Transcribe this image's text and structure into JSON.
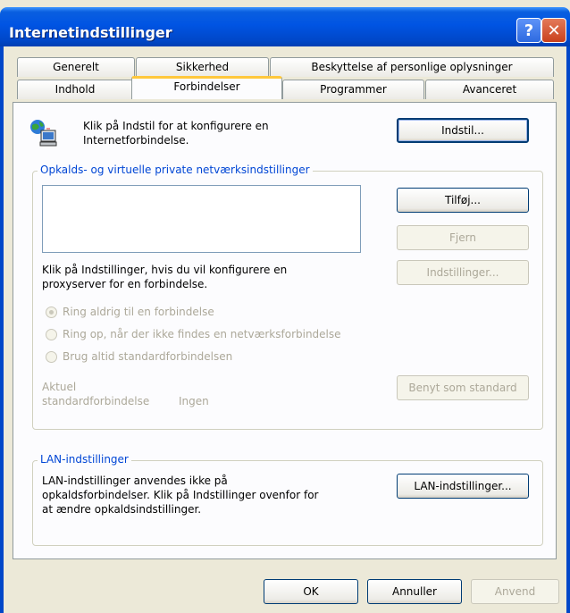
{
  "window": {
    "title": "Internetindstillinger",
    "help_label": "?",
    "close_label": "✕"
  },
  "tabs": {
    "row1": [
      "Generelt",
      "Sikkerhed",
      "Beskyttelse af personlige oplysninger"
    ],
    "row2": [
      "Indhold",
      "Forbindelser",
      "Programmer",
      "Avanceret"
    ],
    "active": "Forbindelser"
  },
  "connection": {
    "intro_text": "Klik på Indstil for at konfigurere en\nInternetforbindelse.",
    "setup_button": "Indstil...",
    "icon": "network-computer-icon"
  },
  "dialup": {
    "group_label": "Opkalds- og virtuelle private netværksindstillinger",
    "add_button": "Tilføj...",
    "remove_button": "Fjern",
    "settings_button": "Indstillinger...",
    "proxy_text": "Klik på Indstillinger, hvis du vil konfigurere en\nproxyserver for en forbindelse.",
    "radio_never": "Ring aldrig til en forbindelse",
    "radio_when_no_network": "Ring op, når der ikke findes en netværksforbindelse",
    "radio_always": "Brug altid standardforbindelsen",
    "current_label": "Aktuel\nstandardforbindelse",
    "current_value": "Ingen",
    "set_default_button": "Benyt som standard"
  },
  "lan": {
    "group_label": "LAN-indstillinger",
    "text": "LAN-indstillinger anvendes ikke på\nopkaldsforbindelser. Klik på Indstillinger ovenfor for\nat ændre opkaldsindstillinger.",
    "button": "LAN-indstillinger..."
  },
  "footer": {
    "ok": "OK",
    "cancel": "Annuller",
    "apply": "Anvend"
  },
  "colors": {
    "title_bar": "#0054e3",
    "active_tab_accent": "#ffc83c",
    "group_label": "#0046d5"
  }
}
